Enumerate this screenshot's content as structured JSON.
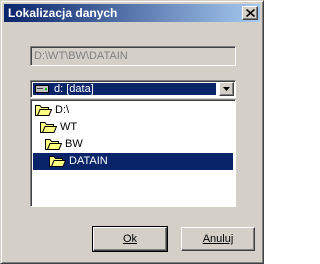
{
  "window": {
    "title": "Lokalizacja danych"
  },
  "path": {
    "value": "D:\\WT\\BW\\DATAIN"
  },
  "drive": {
    "selected": "d: [data]"
  },
  "tree": {
    "items": [
      {
        "label": "D:\\",
        "state": "open"
      },
      {
        "label": "WT",
        "state": "open"
      },
      {
        "label": "BW",
        "state": "open"
      },
      {
        "label": "DATAIN",
        "state": "open",
        "selected": true
      }
    ]
  },
  "buttons": {
    "ok_label": "Ok",
    "cancel_label": "Anuluj"
  },
  "colors": {
    "title_start": "#0a246a",
    "title_end": "#a6caf0",
    "selection": "#0a246a",
    "face": "#d4d0c8",
    "folder": "#ffff80"
  },
  "icons": {
    "close": "close-icon",
    "drive": "hard-drive-icon",
    "dropdown": "chevron-down-icon",
    "folder": "open-folder-icon"
  }
}
